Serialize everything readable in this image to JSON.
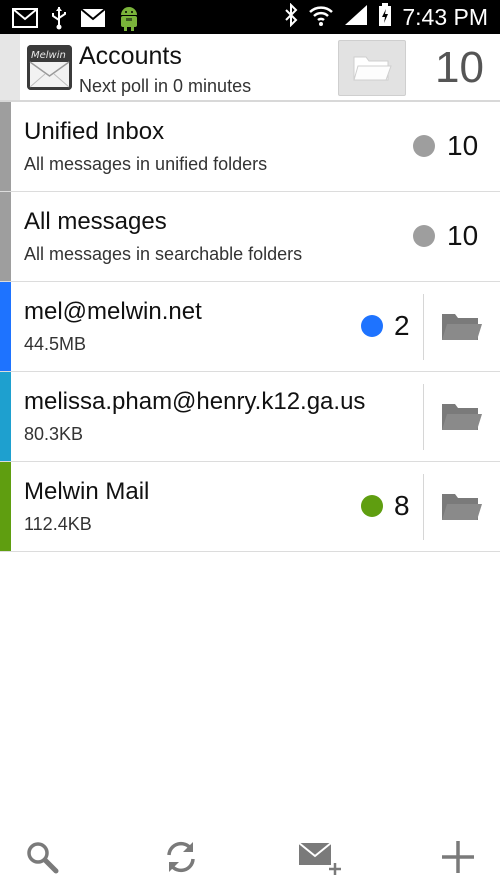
{
  "status_bar": {
    "time": "7:43 PM",
    "icons": [
      "mail-icon",
      "usb-icon",
      "mail-icon",
      "android-icon",
      "bluetooth-icon",
      "wifi-icon",
      "signal-icon",
      "battery-icon"
    ]
  },
  "header": {
    "logo_text": "Melwin",
    "title": "Accounts",
    "subtitle": "Next poll in 0 minutes",
    "unread_count": "10"
  },
  "accounts": [
    {
      "title": "Unified Inbox",
      "subtitle": "All messages in unified folders",
      "count": "10",
      "bar_color": "#9e9e9e",
      "dot_color": "#9e9e9e"
    },
    {
      "title": "All messages",
      "subtitle": "All messages in searchable folders",
      "count": "10",
      "bar_color": "#9e9e9e",
      "dot_color": "#9e9e9e"
    },
    {
      "title": "mel@melwin.net",
      "subtitle": "44.5MB",
      "count": "2",
      "bar_color": "#1e73ff",
      "dot_color": "#1e73ff"
    },
    {
      "title": "melissa.pham@henry.k12.ga.us",
      "subtitle": "80.3KB",
      "count": "",
      "bar_color": "#1ea0cf",
      "dot_color": ""
    },
    {
      "title": "Melwin Mail",
      "subtitle": "112.4KB",
      "count": "8",
      "bar_color": "#5f9e10",
      "dot_color": "#5f9e10"
    }
  ],
  "bottom_bar": {
    "buttons": [
      "search-icon",
      "refresh-icon",
      "compose-icon",
      "add-icon"
    ]
  },
  "colors": {
    "icon_gray": "#7a7a7a",
    "divider": "#dcdcdc"
  }
}
